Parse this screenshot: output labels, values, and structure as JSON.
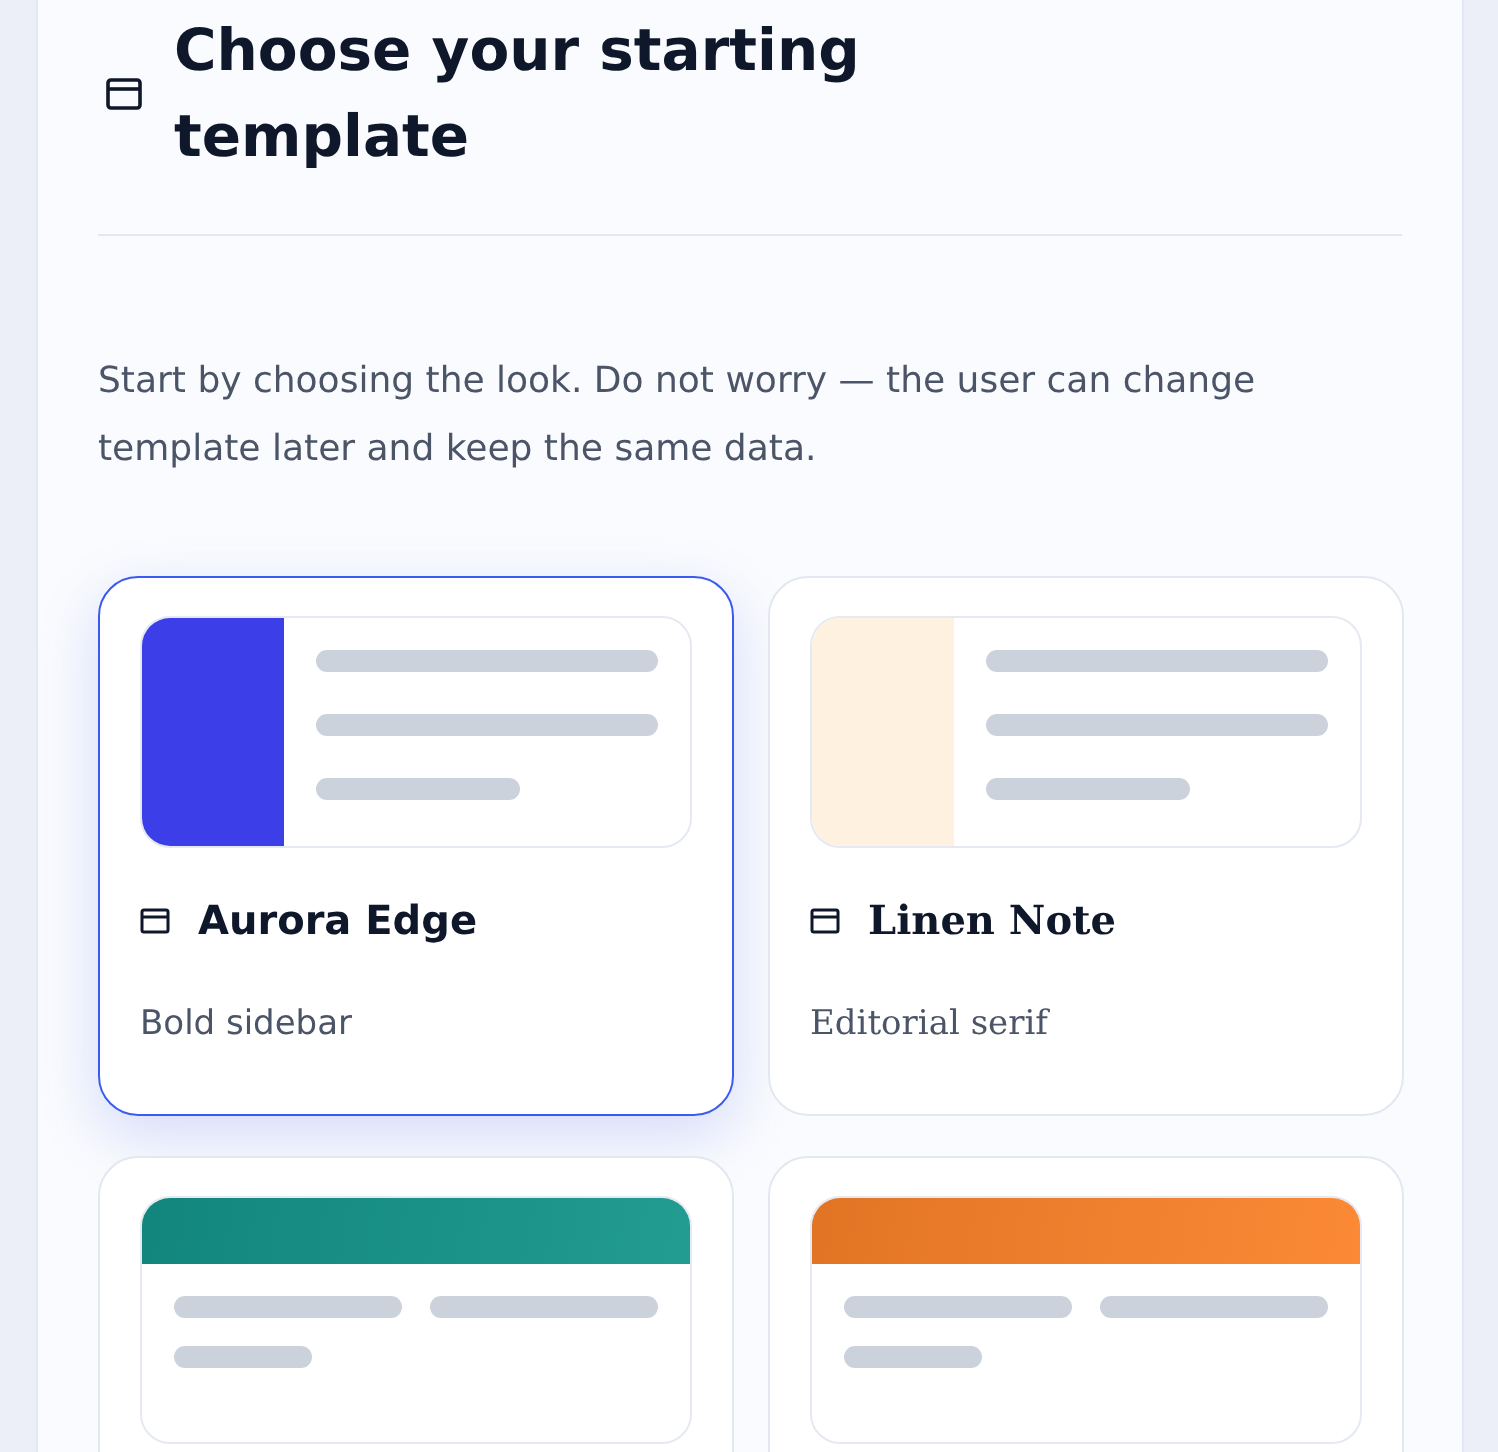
{
  "heading": {
    "title": "Choose your starting template"
  },
  "intro": "Start by choosing the look. Do not worry — the user can change template later and keep the same data.",
  "templates": [
    {
      "name": "Aurora Edge",
      "description": "Bold sidebar",
      "kind": "sidebar",
      "serif": false,
      "selected": true,
      "color": "#3c3fe8"
    },
    {
      "name": "Linen Note",
      "description": "Editorial serif",
      "kind": "sidebar",
      "serif": true,
      "selected": false,
      "color": "#fff1e0"
    },
    {
      "kind": "topband",
      "selected": false,
      "color": "#14958a"
    },
    {
      "kind": "topband",
      "selected": false,
      "color": "#fb8229"
    }
  ]
}
